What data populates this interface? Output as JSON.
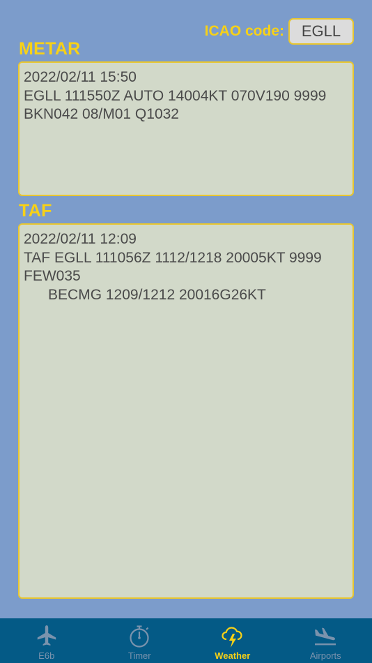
{
  "icao": {
    "label": "ICAO code:",
    "value": "EGLL"
  },
  "metar": {
    "title": "METAR",
    "text": "2022/02/11 15:50\nEGLL 111550Z AUTO 14004KT 070V190 9999\nBKN042 08/M01 Q1032"
  },
  "taf": {
    "title": "TAF",
    "text": "2022/02/11 12:09\nTAF EGLL 111056Z 1112/1218 20005KT 9999\nFEW035\n      BECMG 1209/1212 20016G26KT"
  },
  "tabs": [
    {
      "label": "E6b",
      "icon": "airplane-icon",
      "active": false
    },
    {
      "label": "Timer",
      "icon": "stopwatch-icon",
      "active": false
    },
    {
      "label": "Weather",
      "icon": "storm-cloud-icon",
      "active": true
    },
    {
      "label": "Airports",
      "icon": "airplane-landing-icon",
      "active": false
    }
  ],
  "colors": {
    "background": "#7c9ccb",
    "accent": "#f7d117",
    "tabbar": "#045a86",
    "tab_inactive": "#7a93ad",
    "textbox": "#d2d9c9"
  }
}
